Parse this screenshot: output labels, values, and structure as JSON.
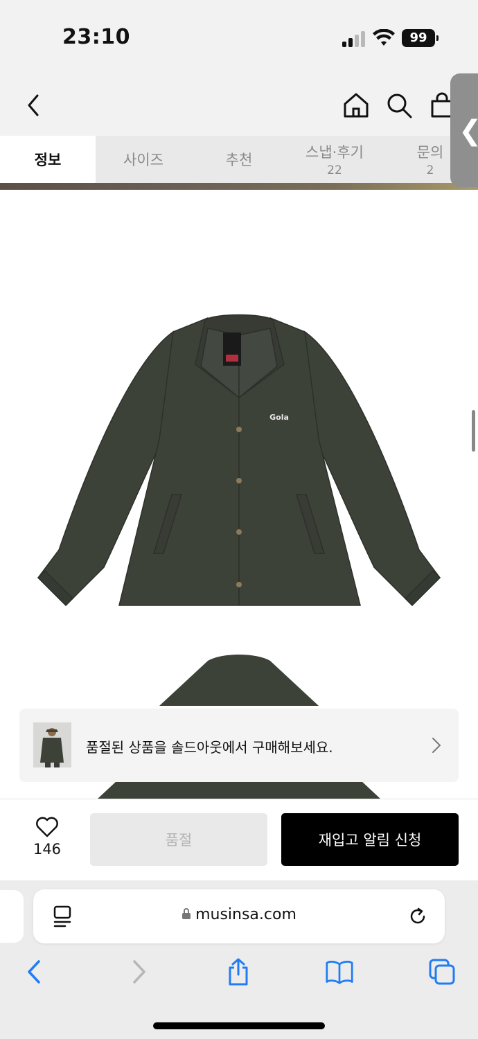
{
  "status_bar": {
    "time": "23:10",
    "battery": "99"
  },
  "header": {
    "back_icon": "chevron-left-icon",
    "home_icon": "home-icon",
    "search_icon": "search-icon",
    "cart_icon": "shopping-bag-icon"
  },
  "tabs": [
    {
      "label": "정보",
      "count": ""
    },
    {
      "label": "사이즈",
      "count": ""
    },
    {
      "label": "추천",
      "count": ""
    },
    {
      "label": "스냅·후기",
      "count": "22"
    },
    {
      "label": "문의",
      "count": "2"
    }
  ],
  "side_handle": {
    "glyph": "❮"
  },
  "product": {
    "brand_logo": "Gola",
    "color": "#3d4239"
  },
  "banner": {
    "text": "품절된 상품을 솔드아웃에서 구매해보세요."
  },
  "action_bar": {
    "like_count": "146",
    "soldout_label": "품절",
    "notify_label": "재입고 알림 신청"
  },
  "safari": {
    "url": "musinsa.com"
  },
  "colors": {
    "accent": "#000000",
    "jacket": "#3d4239",
    "tab_bg": "#e9e9e9",
    "ios_blue": "#1f7cf4"
  }
}
